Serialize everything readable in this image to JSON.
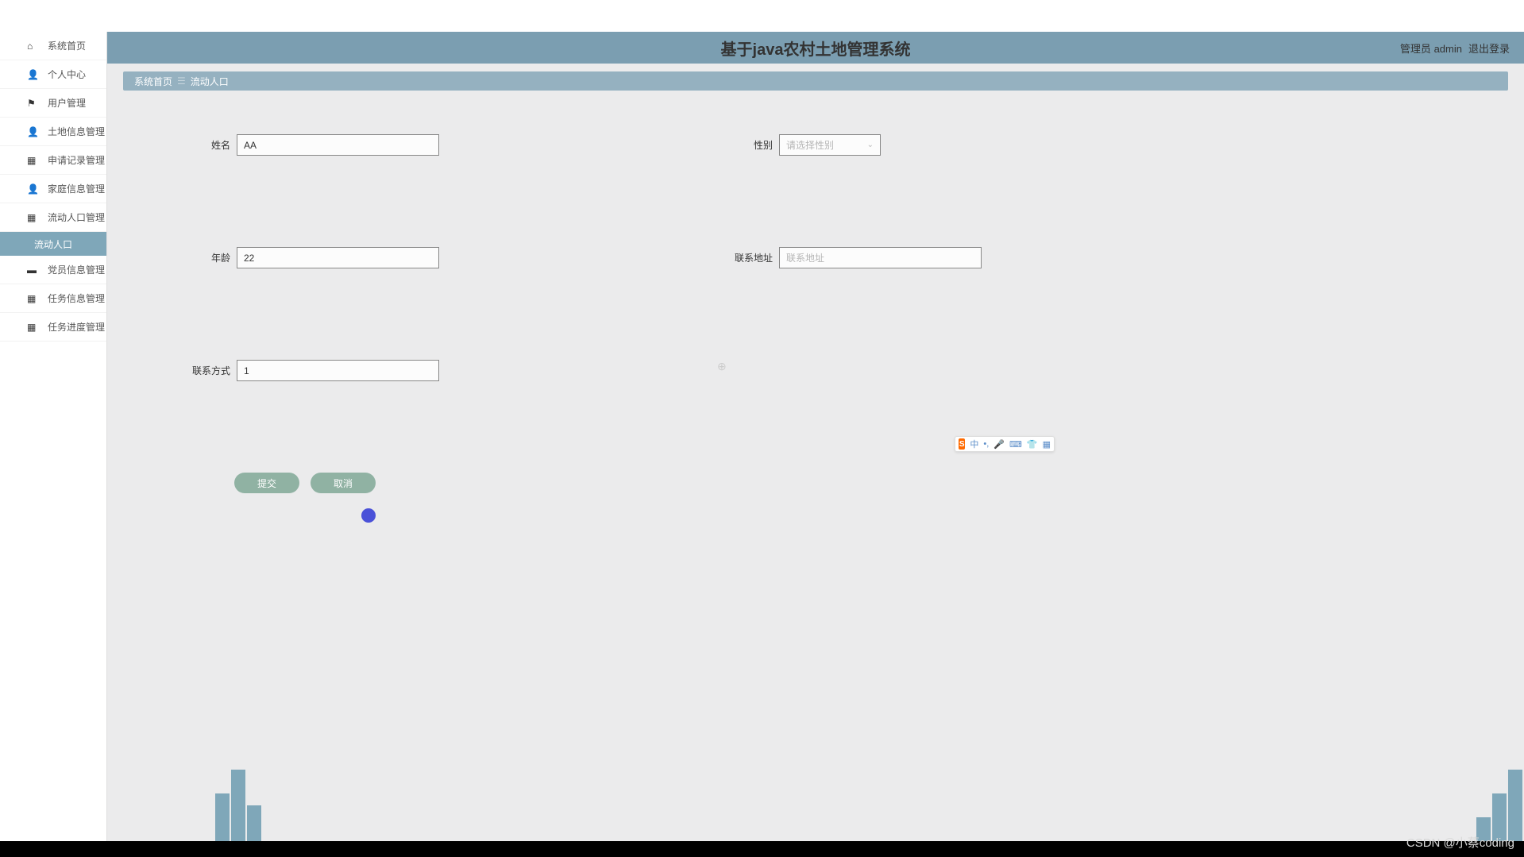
{
  "header": {
    "title": "基于java农村土地管理系统",
    "role_label": "管理员",
    "username": "admin",
    "logout_label": "退出登录"
  },
  "sidebar": {
    "items": [
      {
        "icon": "home",
        "label": "系统首页"
      },
      {
        "icon": "user",
        "label": "个人中心"
      },
      {
        "icon": "flag",
        "label": "用户管理"
      },
      {
        "icon": "user",
        "label": "土地信息管理"
      },
      {
        "icon": "grid",
        "label": "申请记录管理"
      },
      {
        "icon": "user",
        "label": "家庭信息管理"
      },
      {
        "icon": "grid",
        "label": "流动人口管理"
      },
      {
        "icon": "chat",
        "label": "党员信息管理"
      },
      {
        "icon": "grid",
        "label": "任务信息管理"
      },
      {
        "icon": "grid",
        "label": "任务进度管理"
      }
    ],
    "active_sub": "流动人口"
  },
  "breadcrumb": {
    "home": "系统首页",
    "current": "流动人口"
  },
  "form": {
    "name_label": "姓名",
    "name_value": "AA",
    "gender_label": "性别",
    "gender_placeholder": "请选择性别",
    "age_label": "年龄",
    "age_value": "22",
    "address_label": "联系地址",
    "address_placeholder": "联系地址",
    "contact_label": "联系方式",
    "contact_value": "1"
  },
  "buttons": {
    "submit": "提交",
    "cancel": "取消"
  },
  "ime": {
    "lang": "中"
  },
  "watermark": "CSDN @小蔡coding"
}
